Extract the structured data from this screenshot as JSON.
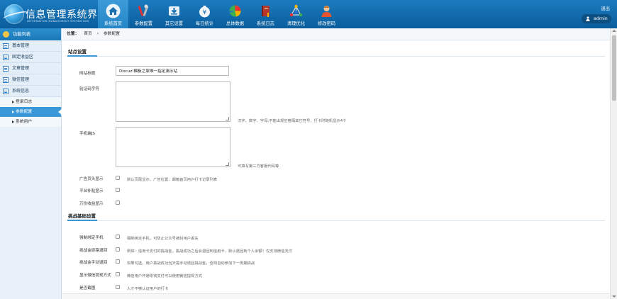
{
  "app": {
    "title": "信息管理系统界面",
    "subtitle": "INFORMATION MANAGEMENT SYSTEM BOX"
  },
  "nav": {
    "items": [
      {
        "label": "系统首页",
        "icon": "home-icon",
        "active": true
      },
      {
        "label": "参数配置",
        "icon": "tools-icon"
      },
      {
        "label": "其它设置",
        "icon": "download-icon"
      },
      {
        "label": "每日统计",
        "icon": "money-bag-icon"
      },
      {
        "label": "总体数据",
        "icon": "pie-chart-icon"
      },
      {
        "label": "系统日志",
        "icon": "book-icon"
      },
      {
        "label": "清理优化",
        "icon": "network-icon"
      },
      {
        "label": "修改密码",
        "icon": "user-icon"
      }
    ]
  },
  "header": {
    "logout": "退出",
    "user": "admin"
  },
  "sidebar": {
    "title": "功能列表",
    "groups": [
      {
        "label": "基本管理"
      },
      {
        "label": "固定收益区"
      },
      {
        "label": "文章管理"
      },
      {
        "label": "微信管理"
      },
      {
        "label": "系统信息"
      }
    ],
    "subitems": [
      {
        "label": "登录日志"
      },
      {
        "label": "参数配置",
        "active": true
      },
      {
        "label": "系统用户"
      }
    ]
  },
  "breadcrumb": {
    "prefix": "位置：",
    "home": "首页",
    "sep": "›",
    "current": "参数配置"
  },
  "site_settings": {
    "title": "站点设置",
    "site_title_label": "网站标题",
    "site_title_value": "Discuz!模板之家唯一指定演示站",
    "captcha_label": "验证码字符",
    "captcha_hint": "汉字、数字、字母,不能出现空格隔其它符号，打卡时随机显示4个",
    "stat_code_label": "手机端JS",
    "stat_code_hint": "可填写第三方客服代码等",
    "ad_top_label": "广告页头显示",
    "ad_top_hint": "默认页尾显示，广告位置：邮箱首页用户打卡记录列表",
    "platform_label": "平台补贴显示",
    "wan_label": "万份收益显示"
  },
  "challenge_settings": {
    "title": "挑战基础设置",
    "bind_phone_label": "强制绑定手机",
    "bind_phone_hint": "强制绑定手机，可防止公众号被封用户丢失",
    "refund_label": "挑战金原路退回",
    "refund_hint": "例如：信用卡支付的挑战金，挑战成功之后会退回到信用卡，默认退回到个人余额！仅支持微信支付",
    "auto_return_label": "挑战金手动退回",
    "auto_return_hint": "如果勾选，用户挑战成功当天需手动退回挑战金，否则自动参加下一周期挑战",
    "wx_withdraw_label": "显示微信提现方式",
    "wx_withdraw_hint": "微信用户开通零钱支付可以使用微信提现方式",
    "cut_label": "是否截图",
    "cut_hint": "人才不够认证用户的打卡"
  }
}
